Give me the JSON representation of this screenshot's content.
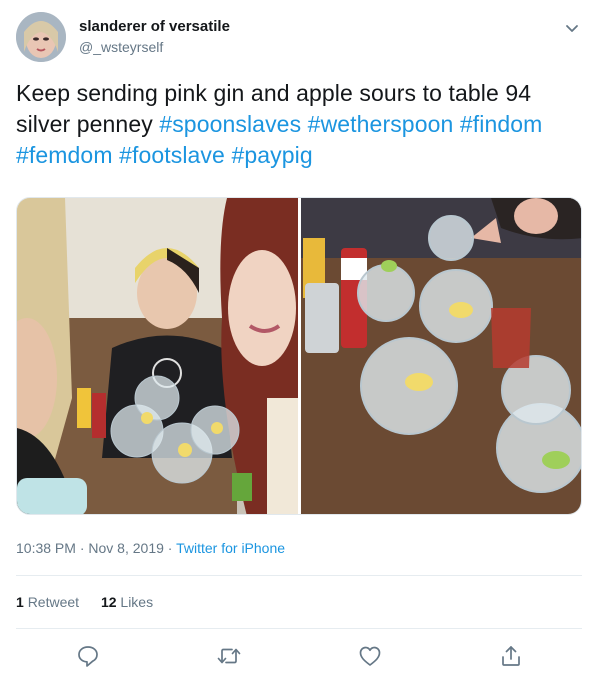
{
  "user": {
    "display_name": "slanderer of versatile",
    "handle": "@_wsteyrself"
  },
  "tweet": {
    "text_plain": "Keep sending pink gin and apple sours to table 94 silver penney ",
    "hashtags": [
      "#spoonslaves",
      "#wetherspoon",
      "#findom",
      "#femdom",
      "#footslave",
      "#paypig"
    ]
  },
  "meta": {
    "time": "10:38 PM",
    "date": "Nov 8, 2019",
    "separator": "·",
    "source": "Twitter for iPhone"
  },
  "stats": {
    "retweet_count": "1",
    "retweet_label": "Retweet",
    "like_count": "12",
    "like_label": "Likes"
  },
  "icons": {
    "caret": "chevron-down-icon",
    "reply": "reply-icon",
    "retweet": "retweet-icon",
    "like": "heart-icon",
    "share": "share-icon"
  },
  "colors": {
    "link": "#1b95e0",
    "secondary_text": "#657786",
    "primary_text": "#14171a"
  }
}
